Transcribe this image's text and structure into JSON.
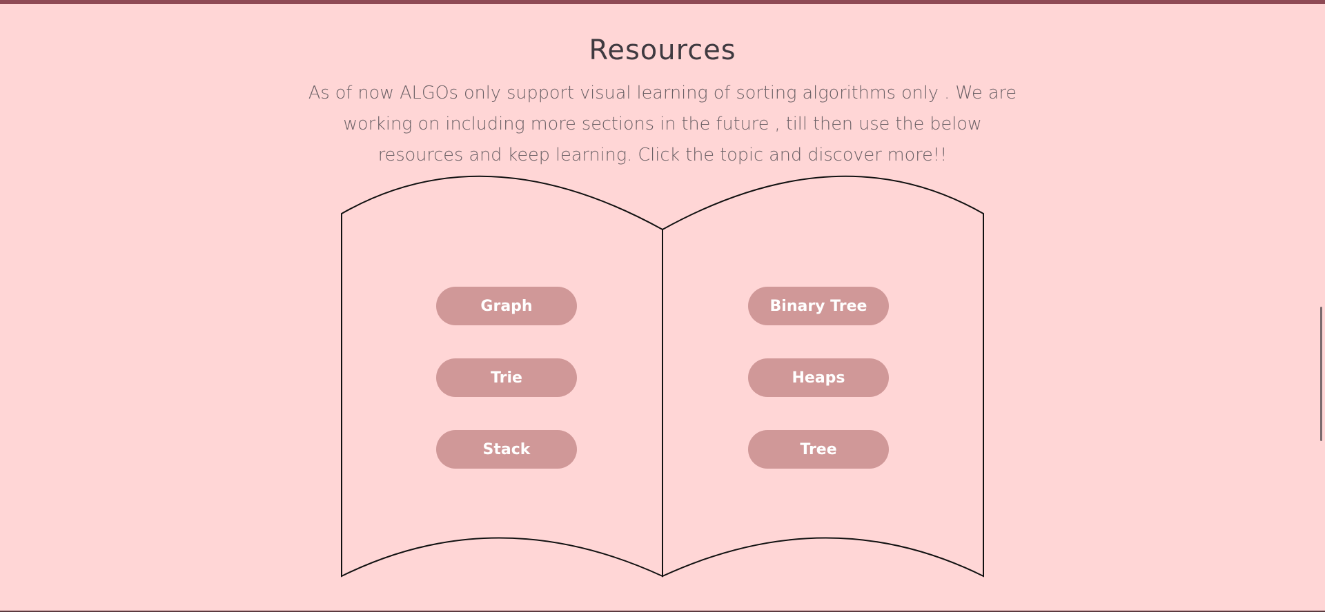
{
  "section": {
    "title": "Resources",
    "description": "As of now ALGOs only support visual learning of sorting algorithms only . We are working on including more sections in the future , till then use the below resources and keep learning. Click the topic and discover more!!"
  },
  "book": {
    "left_page": [
      {
        "label": "Graph"
      },
      {
        "label": "Trie"
      },
      {
        "label": "Stack"
      }
    ],
    "right_page": [
      {
        "label": "Binary Tree"
      },
      {
        "label": "Heaps"
      },
      {
        "label": "Tree"
      }
    ]
  },
  "colors": {
    "background": "#ffd6d6",
    "top_bar": "#8f4a55",
    "button": "#d09898",
    "title": "#3f3a40"
  }
}
